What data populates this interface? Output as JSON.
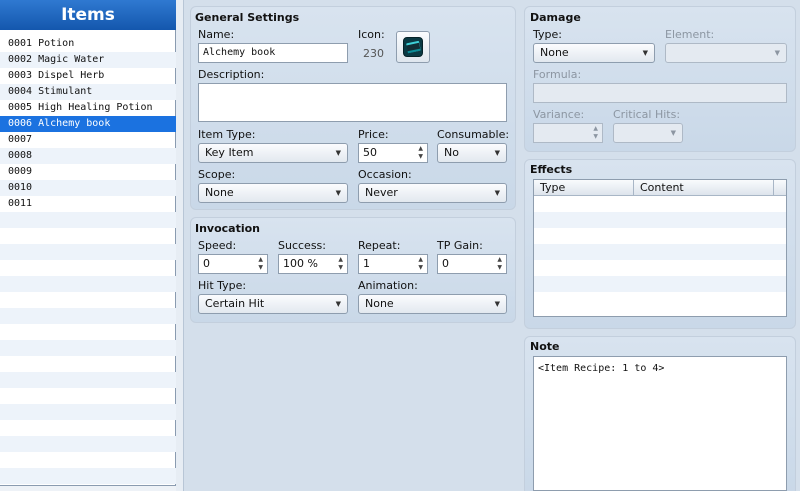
{
  "list": {
    "title": "Items",
    "items": [
      {
        "label": "0001 Potion",
        "selected": false
      },
      {
        "label": "0002 Magic Water",
        "selected": false
      },
      {
        "label": "0003 Dispel Herb",
        "selected": false
      },
      {
        "label": "0004 Stimulant",
        "selected": false
      },
      {
        "label": "0005 High Healing Potion",
        "selected": false
      },
      {
        "label": "0006 Alchemy book",
        "selected": true
      },
      {
        "label": "0007",
        "selected": false
      },
      {
        "label": "0008",
        "selected": false
      },
      {
        "label": "0009",
        "selected": false
      },
      {
        "label": "0010",
        "selected": false
      },
      {
        "label": "0011",
        "selected": false
      }
    ]
  },
  "general": {
    "title": "General Settings",
    "name_label": "Name:",
    "name_value": "Alchemy book",
    "icon_label": "Icon:",
    "icon_index": "230",
    "icon_name": "book-icon",
    "description_label": "Description:",
    "description_value": "",
    "item_type_label": "Item Type:",
    "item_type_value": "Key Item",
    "price_label": "Price:",
    "price_value": "50",
    "consumable_label": "Consumable:",
    "consumable_value": "No",
    "scope_label": "Scope:",
    "scope_value": "None",
    "occasion_label": "Occasion:",
    "occasion_value": "Never"
  },
  "invocation": {
    "title": "Invocation",
    "speed_label": "Speed:",
    "speed_value": "0",
    "success_label": "Success:",
    "success_value": "100 %",
    "repeat_label": "Repeat:",
    "repeat_value": "1",
    "tp_gain_label": "TP Gain:",
    "tp_gain_value": "0",
    "hit_type_label": "Hit Type:",
    "hit_type_value": "Certain Hit",
    "animation_label": "Animation:",
    "animation_value": "None"
  },
  "damage": {
    "title": "Damage",
    "type_label": "Type:",
    "type_value": "None",
    "element_label": "Element:",
    "element_value": "",
    "formula_label": "Formula:",
    "formula_value": "",
    "variance_label": "Variance:",
    "variance_value": "",
    "critical_label": "Critical Hits:",
    "critical_value": ""
  },
  "effects": {
    "title": "Effects",
    "columns": [
      "Type",
      "Content"
    ]
  },
  "note": {
    "title": "Note",
    "value": "<Item Recipe: 1 to 4>"
  },
  "colors": {
    "selection": "#1b72e0",
    "header": "#1b63bd",
    "panel": "#d4dfeb"
  }
}
